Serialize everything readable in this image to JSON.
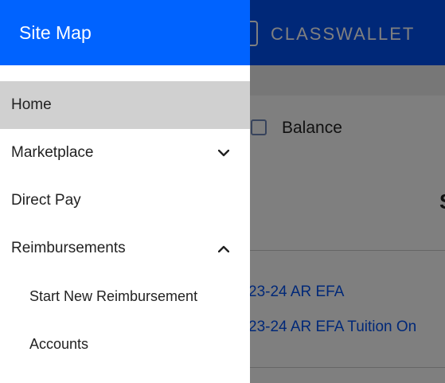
{
  "app": {
    "brand": "CLASSWALLET",
    "balance_label": "Balance",
    "cutoff_glyph": "S",
    "accounts": [
      "23-24 AR EFA",
      "23-24 AR EFA Tuition On"
    ]
  },
  "drawer": {
    "title": "Site Map",
    "items": [
      {
        "label": "Home",
        "active": true
      },
      {
        "label": "Marketplace",
        "chevron": "chevron-down-icon"
      },
      {
        "label": "Direct Pay"
      },
      {
        "label": "Reimbursements",
        "chevron": "chevron-up-icon"
      },
      {
        "label": "Start New Reimbursement",
        "sub": true
      },
      {
        "label": "Accounts",
        "sub": true
      }
    ]
  },
  "colors": {
    "header_blue": "#0063ff",
    "app_header_blue": "#0050f0",
    "active_item": "#d0d0d0",
    "link_blue": "#0050f0"
  }
}
